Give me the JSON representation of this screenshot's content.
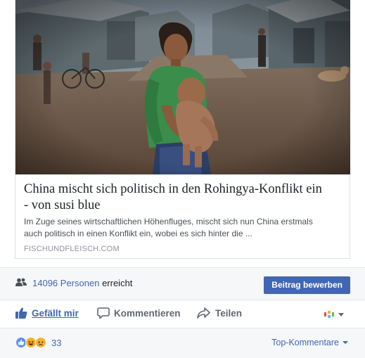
{
  "preview": {
    "image_icon": "photo-village-girl-with-child",
    "title_line1": "China mischt sich politisch in den Rohingya-Konflikt ein",
    "title_line2": "- von susi blue",
    "description_line1": "Im Zuge seines wirtschaftlichen Höhenfluges, mischt sich nun China erstmals",
    "description_line2": "auch politisch in einen Konflikt ein, wobei es sich hinter die ...",
    "domain": "FISCHUNDFLEISCH.COM"
  },
  "reach": {
    "icon": "people-icon",
    "count": "14096",
    "people_label": "Personen",
    "suffix": "erreicht",
    "boost_button": "Beitrag bewerben"
  },
  "actions": {
    "like": "Gefällt mir",
    "comment": "Kommentieren",
    "share": "Teilen",
    "selector_icon": "page-avatar-icon"
  },
  "reactions": {
    "icons": [
      "like-reaction-icon",
      "haha-reaction-icon",
      "sad-reaction-icon"
    ],
    "count": "33",
    "sort_label": "Top-Kommentare"
  },
  "colors": {
    "brand_blue": "#4267b2",
    "secondary_text": "#606770",
    "like_reaction": "#5890ff",
    "emoji_yellow": "#f7b125"
  }
}
